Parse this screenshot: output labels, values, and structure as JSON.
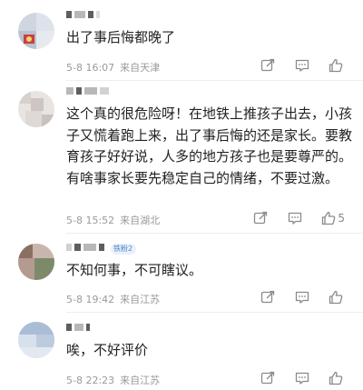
{
  "comments": [
    {
      "text": "出了事后悔都晚了",
      "date": "5-8 16:07",
      "location": "来自天津",
      "likes": ""
    },
    {
      "text": "这个真的很危险呀！在地铁上推孩子出去，小孩子又慌着跑上来，出了事后悔的还是家长。要教育孩子好好说，人多的地方孩子也是要尊严的。有啥事家长要先稳定自己的情绪，不要过激。",
      "date": "5-8 15:52",
      "location": "来自湖北",
      "likes": "5"
    },
    {
      "badge": "铁粉2",
      "text": "不知何事，不可瞎议。",
      "date": "5-8 19:42",
      "location": "来自江苏",
      "likes": ""
    },
    {
      "text": "唉，不好评价",
      "date": "5-8 22:23",
      "location": "来自江苏",
      "likes": ""
    }
  ],
  "colors": {
    "meta": "#9a9a9a",
    "badge_bg": "#e9f1fb",
    "badge_fg": "#4f86c6",
    "icon": "#8a8a8a"
  },
  "icons": [
    "share-icon",
    "comment-icon",
    "like-icon"
  ]
}
